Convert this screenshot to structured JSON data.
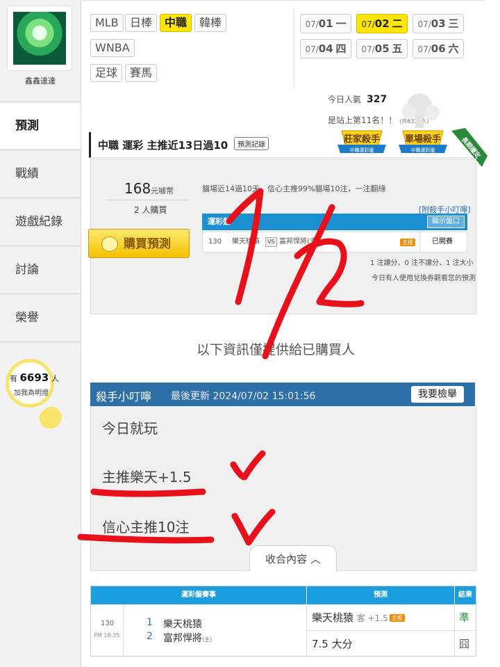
{
  "sidebar": {
    "username": "鑫鑫達達",
    "nav": [
      "預測",
      "戰績",
      "遊戲紀錄",
      "討論",
      "榮譽"
    ],
    "fans_prefix": "有",
    "fans_count": "6693",
    "fans_suffix": "人",
    "fans_sub": "加我為明燈"
  },
  "leagues": [
    "MLB",
    "日棒",
    "中職",
    "韓棒",
    "WNBA",
    "足球",
    "賽馬"
  ],
  "active_league": "中職",
  "dates": [
    {
      "prefix": "07/",
      "day": "01",
      "wd": "一"
    },
    {
      "prefix": "07/",
      "day": "02",
      "wd": "二"
    },
    {
      "prefix": "07/",
      "day": "03",
      "wd": "三"
    },
    {
      "prefix": "07/",
      "day": "04",
      "wd": "四"
    },
    {
      "prefix": "07/",
      "day": "05",
      "wd": "五"
    },
    {
      "prefix": "07/",
      "day": "06",
      "wd": "六"
    }
  ],
  "popularity": {
    "label": "今日人氣",
    "value": "327",
    "rank": "是站上第11名！！",
    "rank_small": "(共6338人)"
  },
  "title": {
    "text": "中職 運彩 主推近13日過10",
    "record_btn": "預測記錄"
  },
  "badges": {
    "b1_main": "莊家殺手",
    "b1_sub": "中職運彩盤",
    "b2_main": "單場殺手",
    "b2_sub": "中職運彩盤",
    "b3": "長期穩定"
  },
  "purchase": {
    "price": "168",
    "price_unit": "元噱幣",
    "buyers": "2",
    "buyers_unit": "人購買",
    "buy_btn": "購買預測",
    "description": "貓場近14過10天，信心主推99%貓場10注，一注翻綠",
    "link": "[附殺手小叮嚀]",
    "table_header": "運彩盤",
    "show_btn": "顯示盤口",
    "row": {
      "no": "130",
      "home": "樂天桃猿",
      "vs": "VS",
      "away": "富邦悍將(主)",
      "tag": "主推",
      "status": "已開賽"
    },
    "note1": "1 注讓分、0 注不讓分、1 注大小",
    "note2": "今日有人使用兌換券觀看您的預測"
  },
  "info_line": "以下資訊僅提供給已購買人",
  "killer": {
    "title": "殺手小叮嚀",
    "updated": "最後更新 2024/07/02 15:01:56",
    "report_btn": "我要檢舉",
    "lines": [
      "今日就玩",
      "主推樂天+1.5",
      "信心主推10注"
    ],
    "collapse": "收合內容 ︿"
  },
  "results": {
    "headers": [
      "運彩盤賽事",
      "預測",
      "結果"
    ],
    "no": "130",
    "time": "PM 18:35",
    "team1_num": "1",
    "team1": "樂天桃猿",
    "team2_num": "2",
    "team2": "富邦悍將",
    "team2_tag": "(主)",
    "pick1": "樂天桃猿",
    "pick1_side": "客 +1.5",
    "pick1_tag": "主推",
    "pick2": "7.5 大分",
    "result1": "準",
    "result2": "囧"
  },
  "colors": {
    "accent_yellow": "#ffe600",
    "header_blue": "#1a8fd1",
    "killer_blue": "#2d6fa7",
    "annotation_red": "#e8101a"
  },
  "annotation_text": "1/2"
}
